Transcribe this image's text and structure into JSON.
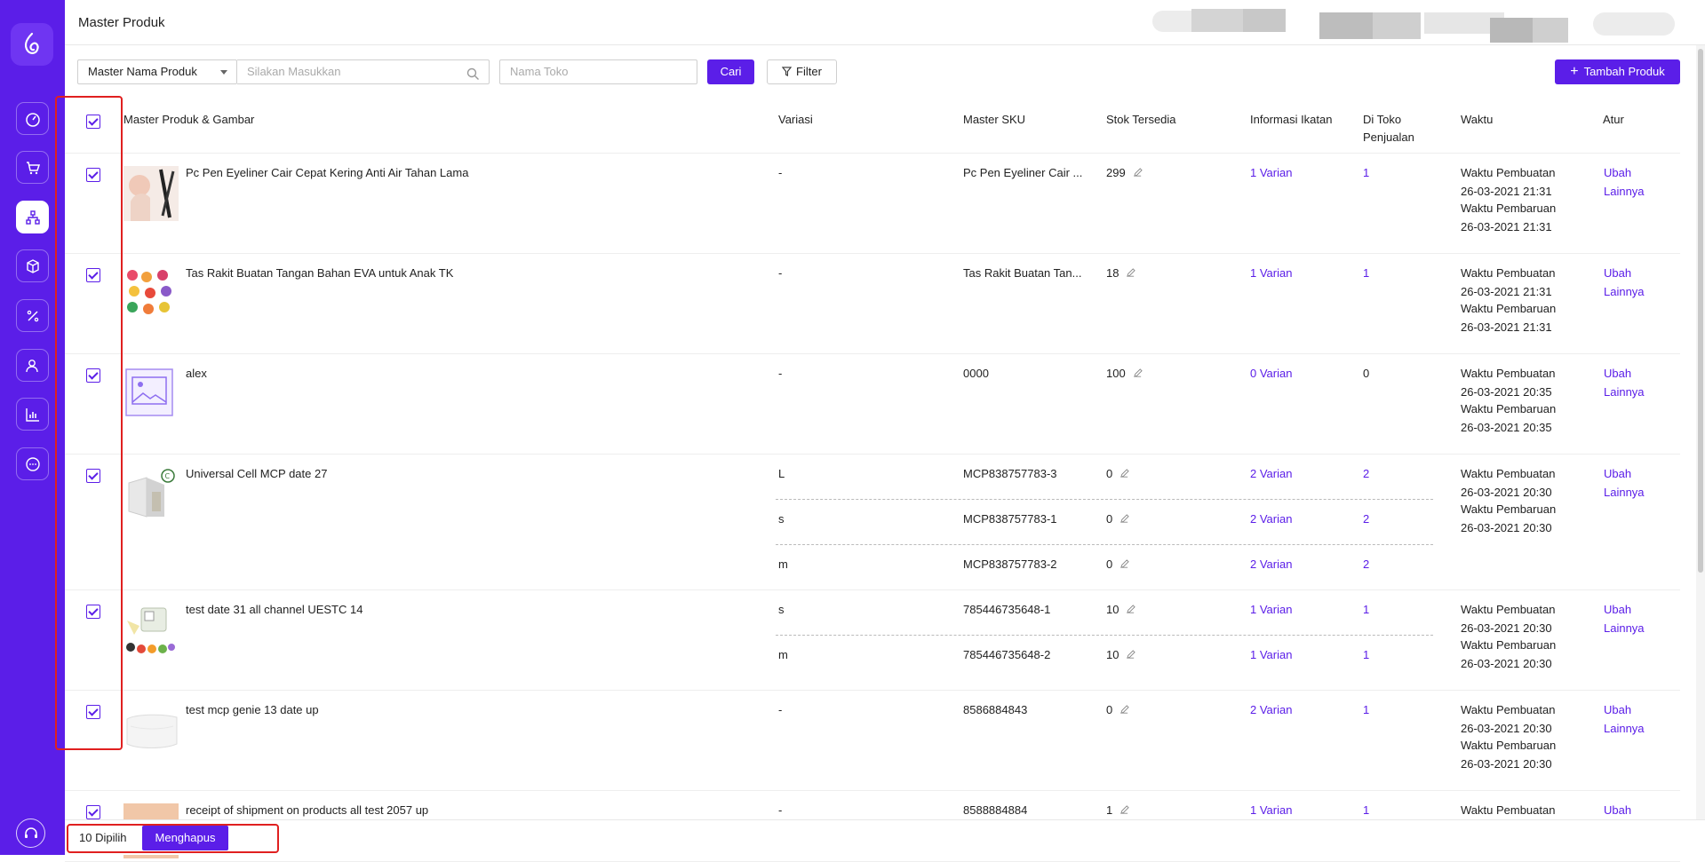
{
  "page_title": "Master Produk",
  "toolbar": {
    "search_field_select": "Master Nama Produk",
    "search_placeholder": "Silakan Masukkan",
    "store_placeholder": "Nama Toko",
    "search_button": "Cari",
    "filter_button": "Filter",
    "add_button": "Tambah Produk"
  },
  "columns": {
    "product": "Master Produk & Gambar",
    "variation": "Variasi",
    "sku": "Master SKU",
    "stock": "Stok Tersedia",
    "binding": "Informasi Ikatan",
    "store_line1": "Di Toko",
    "store_line2": "Penjualan",
    "time": "Waktu",
    "action": "Atur"
  },
  "labels": {
    "created": "Waktu Pembuatan",
    "updated": "Waktu Pembaruan",
    "edit": "Ubah",
    "more": "Lainnya"
  },
  "products": [
    {
      "name": "Pc Pen Eyeliner Cair Cepat Kering Anti Air Tahan Lama",
      "thumb": "eyeliner",
      "variants": [
        {
          "var": "-",
          "sku": "Pc Pen Eyeliner Cair ...",
          "stock": "299",
          "bind": "1 Varian",
          "store": "1"
        }
      ],
      "created": "26-03-2021 21:31",
      "updated": "26-03-2021 21:31"
    },
    {
      "name": "Tas Rakit Buatan Tangan Bahan EVA untuk Anak TK",
      "thumb": "bags",
      "variants": [
        {
          "var": "-",
          "sku": "Tas Rakit Buatan Tan...",
          "stock": "18",
          "bind": "1 Varian",
          "store": "1"
        }
      ],
      "created": "26-03-2021 21:31",
      "updated": "26-03-2021 21:31"
    },
    {
      "name": "alex",
      "thumb": "placeholder",
      "variants": [
        {
          "var": "-",
          "sku": "0000",
          "stock": "100",
          "bind": "0 Varian",
          "store": "0"
        }
      ],
      "created": "26-03-2021 20:35",
      "updated": "26-03-2021 20:35"
    },
    {
      "name": "Universal Cell MCP date 27",
      "thumb": "box",
      "variants": [
        {
          "var": "L",
          "sku": "MCP838757783-3",
          "stock": "0",
          "bind": "2 Varian",
          "store": "2"
        },
        {
          "var": "s",
          "sku": "MCP838757783-1",
          "stock": "0",
          "bind": "2 Varian",
          "store": "2"
        },
        {
          "var": "m",
          "sku": "MCP838757783-2",
          "stock": "0",
          "bind": "2 Varian",
          "store": "2"
        }
      ],
      "created": "26-03-2021 20:30",
      "updated": "26-03-2021 20:30"
    },
    {
      "name": "test date 31 all channel UESTC 14",
      "thumb": "machine",
      "variants": [
        {
          "var": "s",
          "sku": "785446735648-1",
          "stock": "10",
          "bind": "1 Varian",
          "store": "1"
        },
        {
          "var": "m",
          "sku": "785446735648-2",
          "stock": "10",
          "bind": "1 Varian",
          "store": "1"
        }
      ],
      "created": "26-03-2021 20:30",
      "updated": "26-03-2021 20:30"
    },
    {
      "name": "test mcp genie 13 date up",
      "thumb": "pillow",
      "variants": [
        {
          "var": "-",
          "sku": "8586884843",
          "stock": "0",
          "bind": "2 Varian",
          "store": "1"
        }
      ],
      "created": "26-03-2021 20:30",
      "updated": "26-03-2021 20:30"
    },
    {
      "name": "receipt of shipment on products all test 2057 up",
      "thumb": "beige",
      "variants": [
        {
          "var": "-",
          "sku": "8588884884",
          "stock": "1",
          "bind": "1 Varian",
          "store": "1"
        }
      ],
      "created": "",
      "updated": ""
    }
  ],
  "bottom_bar": {
    "selected_count": "10 Dipilih",
    "delete_button": "Menghapus"
  },
  "colors": {
    "accent": "#5b1ee8",
    "highlight": "#e02020"
  }
}
